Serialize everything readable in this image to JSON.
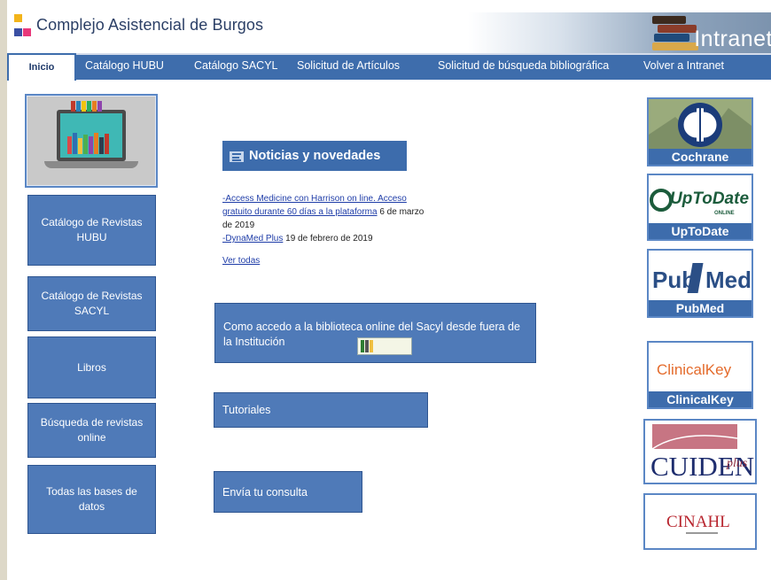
{
  "header": {
    "site_title": "Complejo Asistencial de Burgos",
    "banner_text": "Intranet"
  },
  "nav": {
    "home": "Inicio",
    "items": [
      "Catálogo  HUBU",
      "Catálogo SACYL",
      "Solicitud de Artículos",
      "Solicitud de búsqueda bibliográfica",
      "Volver a Intranet"
    ]
  },
  "sidebar": {
    "items": [
      "Catálogo de Revistas HUBU",
      "Catálogo de Revistas SACYL",
      "Libros",
      "Búsqueda de revistas online",
      "Todas las bases de datos"
    ]
  },
  "news": {
    "title": "Noticias y novedades",
    "item1_link": "-Access Medicine con Harrison on line. Acceso gratuito durante 60 días a la plataforma",
    "item1_date": " 6  de marzo de 2019",
    "item2_link": "-DynaMed Plus",
    "item2_date": " 19 de febrero de 2019",
    "see_all": "Ver todas"
  },
  "center_buttons": {
    "access": "Como accedo a la biblioteca online del Sacyl  desde fuera de la Institución",
    "tutorials": "Tutoriales",
    "contact": "Envía tu consulta"
  },
  "databases": {
    "cochrane": "Cochrane",
    "uptodate_logo": "UpToDate",
    "uptodate_online": "ONLINE",
    "uptodate": "UpToDate",
    "pubmed_logo_a": "Pub",
    "pubmed_logo_b": "Med",
    "pubmed": "PubMed",
    "clinicalkey_logo": "ClinicalKey",
    "clinicalkey": "ClinicalKey",
    "cuiden": "CUIDEN",
    "cuiden_plus": "plus",
    "cinahl": "CINAHL"
  },
  "colors": {
    "nav_blue": "#3e6dac",
    "button_blue": "#4f7ab8",
    "link_blue": "#1f3da8"
  }
}
